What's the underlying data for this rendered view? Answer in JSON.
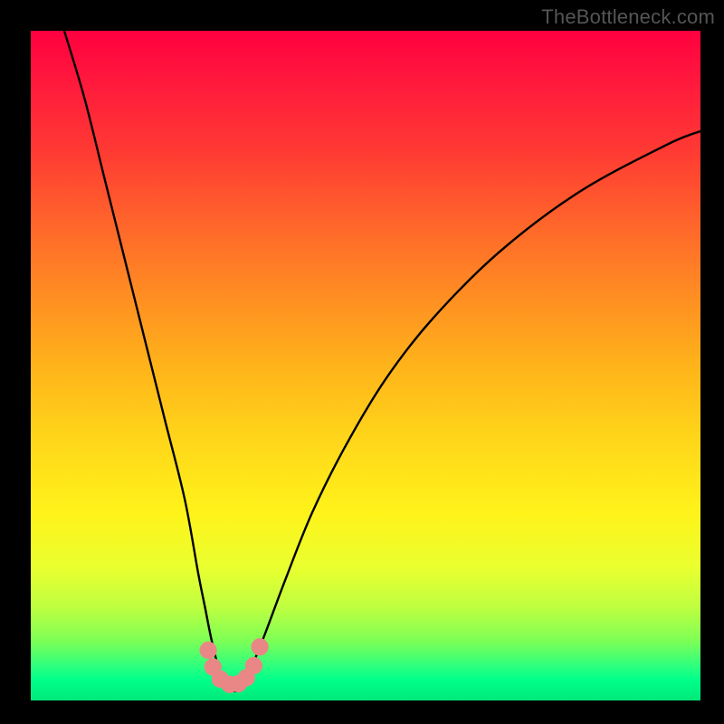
{
  "watermark": {
    "text": "TheBottleneck.com"
  },
  "chart_data": {
    "type": "line",
    "title": "",
    "xlabel": "",
    "ylabel": "",
    "xlim": [
      0,
      100
    ],
    "ylim": [
      0,
      100
    ],
    "series": [
      {
        "name": "bottleneck-curve",
        "x": [
          5,
          8,
          11,
          14,
          17,
          20,
          23,
          25,
          26,
          27,
          28,
          29,
          30,
          31,
          32,
          33,
          35,
          38,
          42,
          47,
          53,
          60,
          70,
          82,
          95,
          100
        ],
        "values": [
          100,
          90,
          78,
          66,
          54,
          42,
          30,
          19,
          14,
          9,
          5,
          2.5,
          1.5,
          1.5,
          2.5,
          5,
          10,
          18,
          28,
          38,
          48,
          57,
          67,
          76,
          83,
          85
        ]
      }
    ],
    "markers": [
      {
        "cx": 26.5,
        "cy": 7.5,
        "r": 1.3,
        "color": "#e98787"
      },
      {
        "cx": 27.2,
        "cy": 5.0,
        "r": 1.3,
        "color": "#e98787"
      },
      {
        "cx": 28.3,
        "cy": 3.2,
        "r": 1.3,
        "color": "#e98787"
      },
      {
        "cx": 29.7,
        "cy": 2.4,
        "r": 1.3,
        "color": "#e98787"
      },
      {
        "cx": 31.0,
        "cy": 2.5,
        "r": 1.3,
        "color": "#e98787"
      },
      {
        "cx": 32.2,
        "cy": 3.4,
        "r": 1.3,
        "color": "#e98787"
      },
      {
        "cx": 33.3,
        "cy": 5.2,
        "r": 1.3,
        "color": "#e98787"
      },
      {
        "cx": 34.2,
        "cy": 8.0,
        "r": 1.3,
        "color": "#e98787"
      }
    ],
    "colors": {
      "curve": "#000000"
    }
  }
}
